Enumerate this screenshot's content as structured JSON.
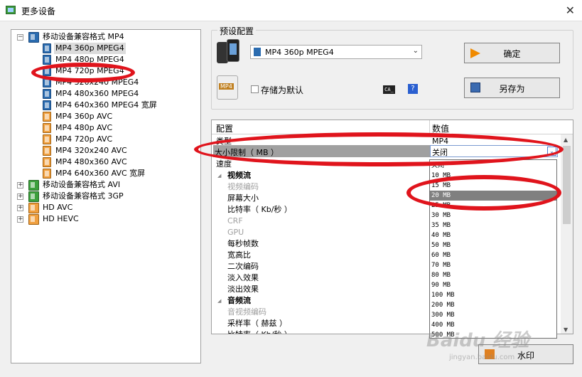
{
  "window": {
    "title": "更多设备",
    "close": "✕"
  },
  "tree": {
    "groups": [
      {
        "label": "移动设备兼容格式 MP4",
        "expander": "−"
      },
      {
        "label": "移动设备兼容格式 AVI",
        "expander": "+"
      },
      {
        "label": "移动设备兼容格式 3GP",
        "expander": "+"
      },
      {
        "label": "HD AVC",
        "expander": "+"
      },
      {
        "label": "HD HEVC",
        "expander": "+"
      }
    ],
    "items": [
      "MP4 360p MPEG4",
      "MP4 480p MPEG4",
      "MP4 720p MPEG4",
      "MP4 320x240 MPEG4",
      "MP4 480x360 MPEG4",
      "MP4 640x360 MPEG4 宽屏",
      "MP4 360p AVC",
      "MP4 480p AVC",
      "MP4 720p AVC",
      "MP4 320x240 AVC",
      "MP4 480x360 AVC",
      "MP4 640x360 AVC 宽屏"
    ]
  },
  "preset": {
    "group_label": "预设配置",
    "selected": "MP4 360p MPEG4",
    "ok_label": "确定",
    "save_as_label": "另存为",
    "default_label": "存储为默认",
    "mp4_badge": "MP4",
    "ca_icon": "CA_",
    "help_icon": "?"
  },
  "grid": {
    "col_config": "配置",
    "col_value": "数值",
    "rows": [
      {
        "name": "类型",
        "value": "MP4",
        "style": "normal",
        "indent": 0
      },
      {
        "name": "大小限制（ MB ）",
        "value": "关闭",
        "style": "selected",
        "indent": 0
      },
      {
        "name": "速度",
        "value": "关闭",
        "style": "normal",
        "indent": 0
      },
      {
        "name": "视频流",
        "value": "",
        "style": "bold",
        "indent": 1
      },
      {
        "name": "视频编码",
        "value": "",
        "style": "gray",
        "indent": 2
      },
      {
        "name": "屏幕大小",
        "value": "",
        "style": "normal",
        "indent": 2
      },
      {
        "name": "比特率（ Kb/秒 ）",
        "value": "",
        "style": "normal",
        "indent": 2
      },
      {
        "name": "CRF",
        "value": "",
        "style": "gray",
        "indent": 2
      },
      {
        "name": "GPU",
        "value": "",
        "style": "gray",
        "indent": 2
      },
      {
        "name": "每秒帧数",
        "value": "",
        "style": "normal",
        "indent": 2
      },
      {
        "name": "宽高比",
        "value": "",
        "style": "normal",
        "indent": 2
      },
      {
        "name": "二次编码",
        "value": "",
        "style": "normal",
        "indent": 2
      },
      {
        "name": "淡入效果",
        "value": "",
        "style": "normal",
        "indent": 2
      },
      {
        "name": "淡出效果",
        "value": "",
        "style": "normal",
        "indent": 2
      },
      {
        "name": "音频流",
        "value": "",
        "style": "bold",
        "indent": 1
      },
      {
        "name": "音视频编码",
        "value": "",
        "style": "gray",
        "indent": 2
      },
      {
        "name": "采样率（ 赫兹 ）",
        "value": "",
        "style": "normal",
        "indent": 2
      },
      {
        "name": "比特率（ Kb/秒 ）",
        "value": "",
        "style": "normal",
        "indent": 2
      }
    ]
  },
  "size_dropdown": {
    "current": "关闭",
    "options": [
      "关闭",
      "10 MB",
      "15 MB",
      "20 MB",
      "25 MB",
      "30 MB",
      "35 MB",
      "40 MB",
      "50 MB",
      "60 MB",
      "70 MB",
      "80 MB",
      "90 MB",
      "100 MB",
      "200 MB",
      "300 MB",
      "400 MB",
      "500 MB"
    ],
    "highlighted": "20 MB"
  },
  "bottom": {
    "watermark_label": "水印"
  },
  "overlay": {
    "baidu": "Baidu 经验",
    "baidu_sub": "jingyan.baidu.com"
  },
  "colors": {
    "annotation": "#e0141c",
    "selected_row": "#a0a0a0",
    "highlight_item": "#808080"
  }
}
